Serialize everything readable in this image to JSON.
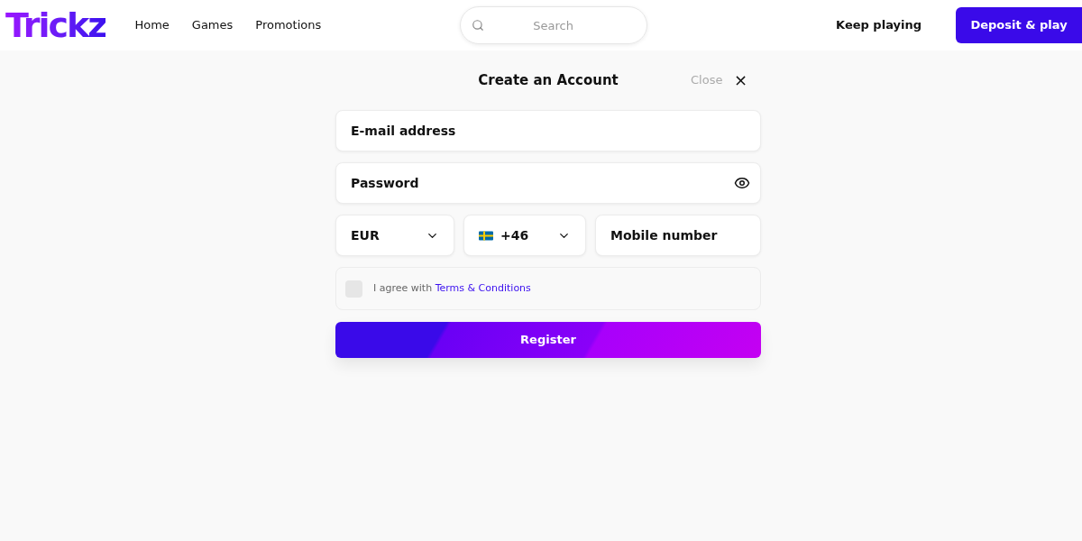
{
  "header": {
    "logo": "Trickz",
    "nav": [
      "Home",
      "Games",
      "Promotions"
    ],
    "search": {
      "placeholder": "Search"
    },
    "keep_playing": "Keep playing",
    "deposit": "Deposit & play"
  },
  "dialog": {
    "title": "Create an Account",
    "close": "Close",
    "close_icon": "×",
    "email": {
      "placeholder": "E-mail address"
    },
    "password": {
      "placeholder": "Password"
    },
    "currency": "EUR",
    "phone_code": "+46",
    "mobile": {
      "placeholder": "Mobile number"
    },
    "agree": {
      "checked": false,
      "text": "I agree with",
      "link": "Terms & Conditions"
    },
    "register": "Register"
  }
}
